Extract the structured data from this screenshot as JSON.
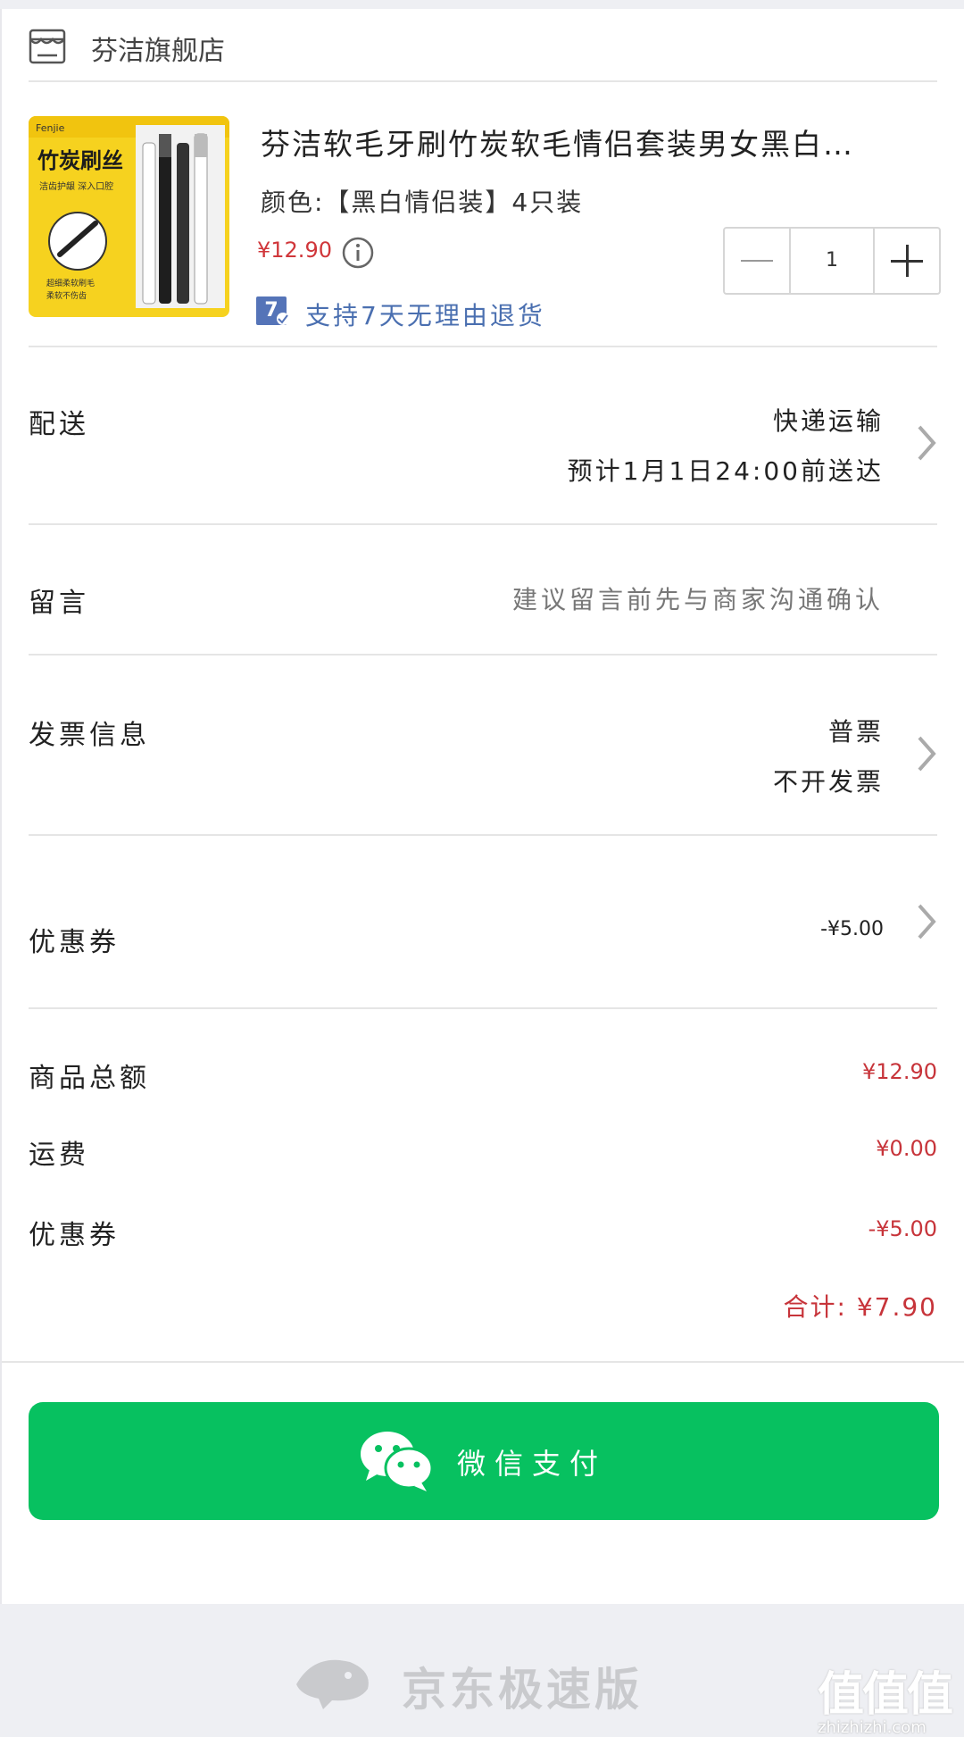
{
  "store": {
    "name": "芬洁旗舰店"
  },
  "product": {
    "title": "芬洁软毛牙刷竹炭软毛情侣套装男女黑白…",
    "spec": "颜色:【黑白情侣装】4只装",
    "price": "¥12.90",
    "return_badge": "7",
    "return_text": "支持7天无理由退货",
    "quantity": "1",
    "image": {
      "brand": "Fenjie",
      "headline": "竹炭刷丝",
      "sub": "洁齿护龈 深入口腔",
      "note1": "超细柔软刷毛",
      "note2": "柔软不伤齿"
    }
  },
  "delivery": {
    "label": "配送",
    "method": "快递运输",
    "eta": "预计1月1日24:00前送达"
  },
  "message": {
    "label": "留言",
    "placeholder": "建议留言前先与商家沟通确认"
  },
  "invoice": {
    "label": "发票信息",
    "type": "普票",
    "status": "不开发票"
  },
  "coupon": {
    "label": "优惠券",
    "value": "-¥5.00"
  },
  "summary": {
    "goods_label": "商品总额",
    "goods_value": "¥12.90",
    "shipping_label": "运费",
    "shipping_value": "¥0.00",
    "coupon_label": "优惠券",
    "coupon_value": "-¥5.00",
    "total": "合计: ¥7.90"
  },
  "pay_button": {
    "label": "微信支付"
  },
  "footer": {
    "brand": "京东极速版",
    "watermark": "值值值",
    "watermark_url": "zhizhizhi.com"
  },
  "colors": {
    "price_red": "#d0363a",
    "wechat_green": "#07c160",
    "return_blue": "#5574b8"
  }
}
